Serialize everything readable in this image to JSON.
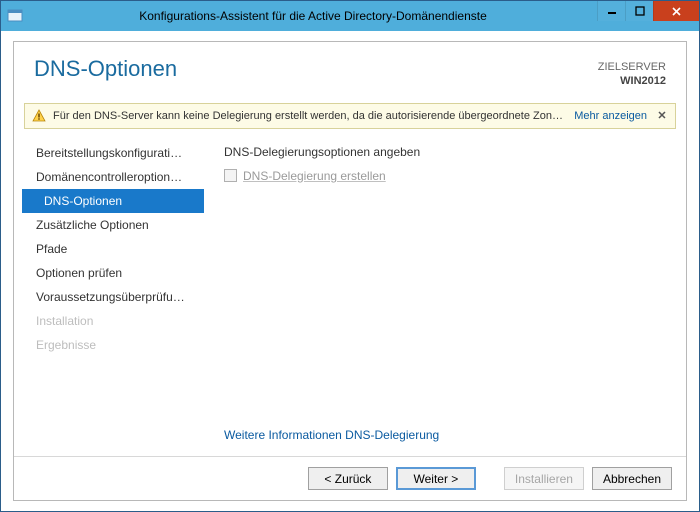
{
  "window": {
    "title": "Konfigurations-Assistent für die Active Directory-Domänendienste"
  },
  "header": {
    "title": "DNS-Optionen",
    "target_label": "ZIELSERVER",
    "target_value": "WIN2012"
  },
  "alert": {
    "message": "Für den DNS-Server kann keine Delegierung erstellt werden, da die autorisierende übergeordnete Zone…",
    "more": "Mehr anzeigen"
  },
  "sidebar": {
    "items": [
      {
        "label": "Bereitstellungskonfigurati…",
        "state": "normal"
      },
      {
        "label": "Domänencontrolleroption…",
        "state": "normal"
      },
      {
        "label": "DNS-Optionen",
        "state": "active"
      },
      {
        "label": "Zusätzliche Optionen",
        "state": "normal"
      },
      {
        "label": "Pfade",
        "state": "normal"
      },
      {
        "label": "Optionen prüfen",
        "state": "normal"
      },
      {
        "label": "Voraussetzungsüberprüfu…",
        "state": "normal"
      },
      {
        "label": "Installation",
        "state": "disabled"
      },
      {
        "label": "Ergebnisse",
        "state": "disabled"
      }
    ]
  },
  "content": {
    "section_title": "DNS-Delegierungsoptionen angeben",
    "checkbox_label": "DNS-Delegierung erstellen",
    "checkbox_enabled": false,
    "more_link": "Weitere Informationen DNS-Delegierung"
  },
  "footer": {
    "back": "< Zurück",
    "next": "Weiter >",
    "install": "Installieren",
    "cancel": "Abbrechen"
  }
}
